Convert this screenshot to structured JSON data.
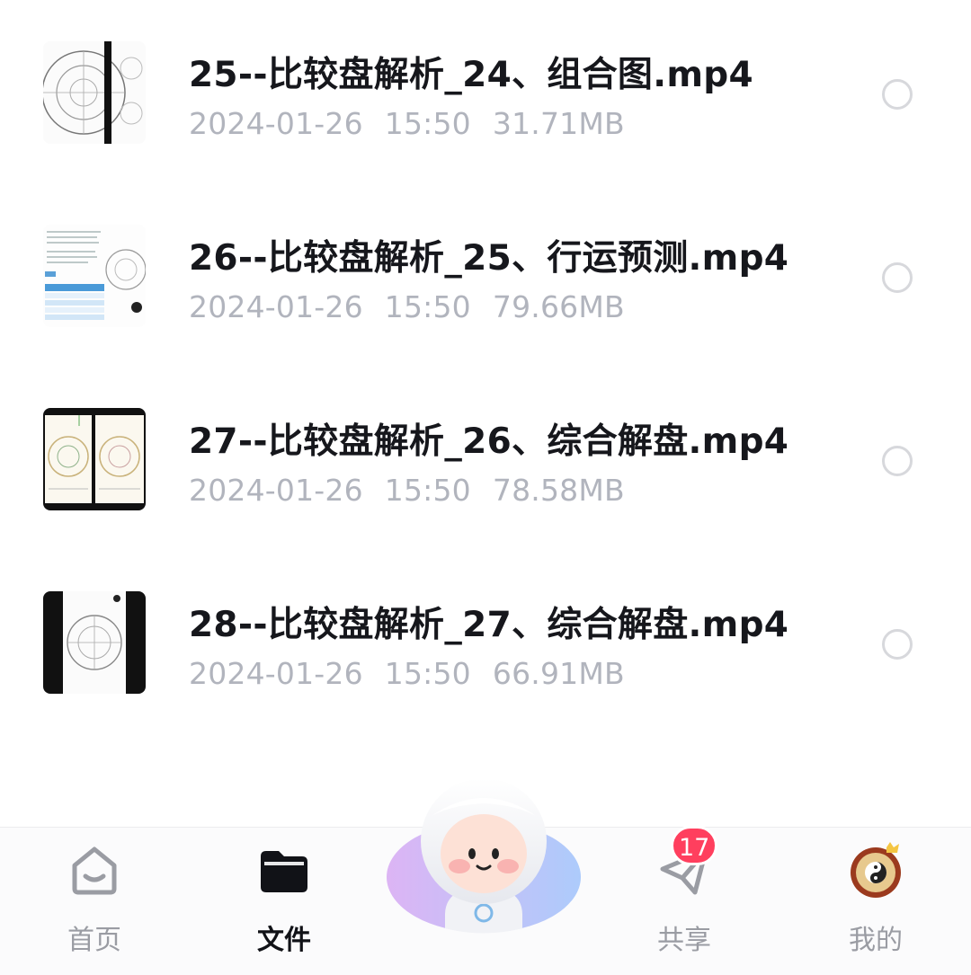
{
  "files": [
    {
      "name": "25--比较盘解析_24、组合图.mp4",
      "date": "2024-01-26",
      "time": "15:50",
      "size": "31.71MB"
    },
    {
      "name": "26--比较盘解析_25、行运预测.mp4",
      "date": "2024-01-26",
      "time": "15:50",
      "size": "79.66MB"
    },
    {
      "name": "27--比较盘解析_26、综合解盘.mp4",
      "date": "2024-01-26",
      "time": "15:50",
      "size": "78.58MB"
    },
    {
      "name": "28--比较盘解析_27、综合解盘.mp4",
      "date": "2024-01-26",
      "time": "15:50",
      "size": "66.91MB"
    }
  ],
  "tabbar": {
    "home": {
      "label": "首页",
      "icon": "home-icon"
    },
    "files": {
      "label": "文件",
      "icon": "folder-icon"
    },
    "assistant": {
      "icon": "mascot-icon"
    },
    "share": {
      "label": "共享",
      "icon": "paper-plane-icon",
      "badge": "17"
    },
    "mine": {
      "label": "我的",
      "icon": "avatar"
    }
  },
  "colors": {
    "badge": "#ff3f5e",
    "active_tab": "#111217",
    "inactive_tab": "#9a9ca3",
    "meta_text": "#b1b4bd"
  }
}
